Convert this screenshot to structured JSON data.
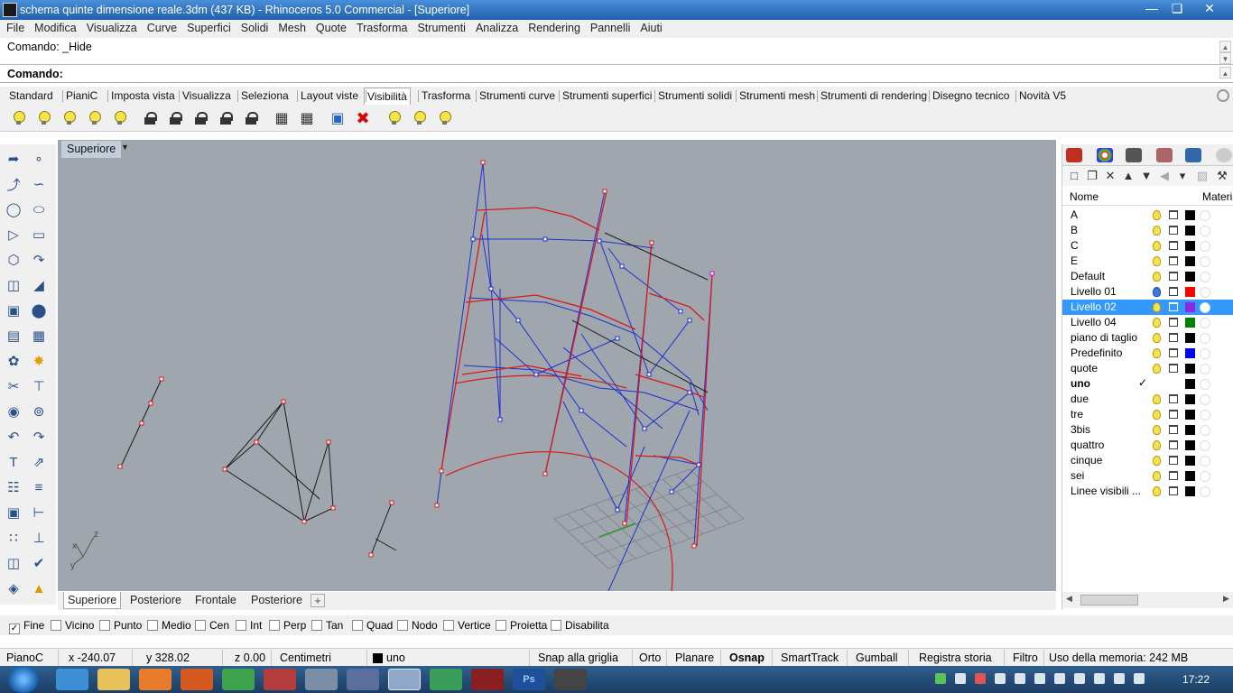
{
  "window": {
    "title": "schema quinte dimensione reale.3dm (437 KB) - Rhinoceros 5.0 Commercial - [Superiore]"
  },
  "menu": [
    "File",
    "Modifica",
    "Visualizza",
    "Curve",
    "Superfici",
    "Solidi",
    "Mesh",
    "Quote",
    "Trasforma",
    "Strumenti",
    "Analizza",
    "Rendering",
    "Pannelli",
    "Aiuti"
  ],
  "command": {
    "history": "Comando: _Hide",
    "prompt": "Comando:",
    "value": ""
  },
  "toolbar_tabs": [
    "Standard",
    "PianiC",
    "Imposta vista",
    "Visualizza",
    "Seleziona",
    "Layout viste",
    "Visibilità",
    "Trasforma",
    "Strumenti curve",
    "Strumenti superfici",
    "Strumenti solidi",
    "Strumenti mesh",
    "Strumenti di rendering",
    "Disegno tecnico",
    "Novità V5"
  ],
  "active_toolbar_tab": "Visibilità",
  "viewport": {
    "title": "Superiore"
  },
  "viewport_tabs": [
    "Superiore",
    "Posteriore",
    "Frontale",
    "Posteriore"
  ],
  "active_viewport_tab": "Superiore",
  "layers_panel": {
    "columns": {
      "name": "Nome",
      "material": "Materia"
    },
    "layers": [
      {
        "name": "A",
        "color": "#000000"
      },
      {
        "name": "B",
        "color": "#000000"
      },
      {
        "name": "C",
        "color": "#000000"
      },
      {
        "name": "E",
        "color": "#000000"
      },
      {
        "name": "Default",
        "color": "#000000"
      },
      {
        "name": "Livello 01",
        "color": "#ff0000"
      },
      {
        "name": "Livello 02",
        "color": "#8a2be2",
        "selected": true
      },
      {
        "name": "Livello 04",
        "color": "#008000"
      },
      {
        "name": "piano di taglio",
        "color": "#000000"
      },
      {
        "name": "Predefinito",
        "color": "#0000ff"
      },
      {
        "name": "quote",
        "color": "#000000"
      },
      {
        "name": "uno",
        "color": "#000000",
        "current": true,
        "check": "✓"
      },
      {
        "name": "due",
        "color": "#000000"
      },
      {
        "name": "tre",
        "color": "#000000"
      },
      {
        "name": "3bis",
        "color": "#000000"
      },
      {
        "name": "quattro",
        "color": "#000000"
      },
      {
        "name": "cinque",
        "color": "#000000"
      },
      {
        "name": "sei",
        "color": "#000000"
      },
      {
        "name": "Linee visibili ...",
        "color": "#000000"
      }
    ]
  },
  "osnap": [
    {
      "label": "Fine",
      "checked": true
    },
    {
      "label": "Vicino",
      "checked": false
    },
    {
      "label": "Punto",
      "checked": false
    },
    {
      "label": "Medio",
      "checked": false
    },
    {
      "label": "Cen",
      "checked": false
    },
    {
      "label": "Int",
      "checked": false
    },
    {
      "label": "Perp",
      "checked": false
    },
    {
      "label": "Tan",
      "checked": false
    },
    {
      "label": "Quad",
      "checked": false
    },
    {
      "label": "Nodo",
      "checked": false
    },
    {
      "label": "Vertice",
      "checked": false
    },
    {
      "label": "Proietta",
      "checked": false
    },
    {
      "label": "Disabilita",
      "checked": false
    }
  ],
  "status": {
    "cplane": "PianoC",
    "x": "x -240.07",
    "y": "y 328.02",
    "z": "z 0.00",
    "units": "Centimetri",
    "layer": "uno",
    "grid_snap": "Snap alla griglia",
    "ortho": "Orto",
    "planar": "Planare",
    "osnap": "Osnap",
    "smarttrack": "SmartTrack",
    "gumball": "Gumball",
    "history": "Registra storia",
    "filter": "Filtro",
    "memory": "Uso della memoria: 242 MB"
  },
  "taskbar": {
    "time": "17:22",
    "ps_label": "Ps"
  },
  "axes": {
    "x": "x",
    "y": "y",
    "z": "z"
  }
}
